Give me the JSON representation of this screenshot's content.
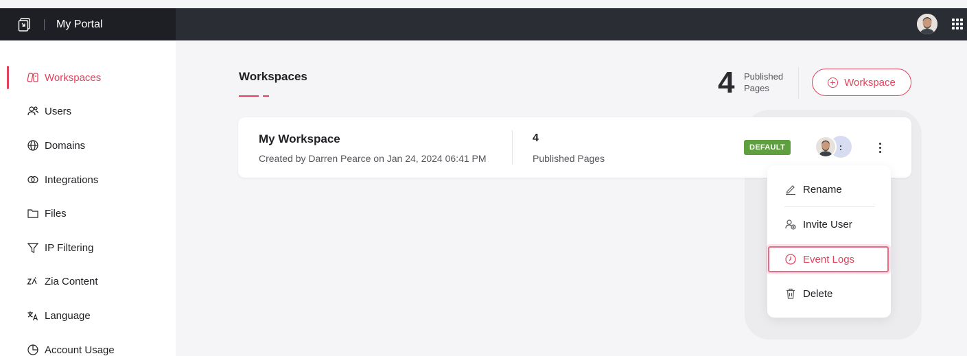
{
  "header": {
    "app_title": "My Portal",
    "logo_icon": "portal-logo-icon",
    "apps_icon": "grid-apps-icon"
  },
  "sidebar": {
    "items": [
      {
        "label": "Workspaces",
        "icon": "workspaces-icon",
        "active": true
      },
      {
        "label": "Users",
        "icon": "users-icon"
      },
      {
        "label": "Domains",
        "icon": "globe-icon"
      },
      {
        "label": "Integrations",
        "icon": "integrations-icon"
      },
      {
        "label": "Files",
        "icon": "folder-icon"
      },
      {
        "label": "IP Filtering",
        "icon": "filter-icon"
      },
      {
        "label": "Zia Content",
        "icon": "zia-icon"
      },
      {
        "label": "Language",
        "icon": "translate-icon"
      },
      {
        "label": "Account Usage",
        "icon": "pie-chart-icon"
      }
    ]
  },
  "main": {
    "title": "Workspaces",
    "stat": {
      "value": "4",
      "label": "Published Pages"
    },
    "add_button_label": "Workspace"
  },
  "workspace_card": {
    "name": "My Workspace",
    "created": "Created by Darren Pearce on Jan 24, 2024 06:41 PM",
    "published_count": "4",
    "published_label": "Published Pages",
    "badge": "DEFAULT",
    "avatar2_text": ":"
  },
  "menu": {
    "items": [
      {
        "label": "Rename",
        "icon": "pencil-icon"
      },
      {
        "label": "Invite User",
        "icon": "invite-user-icon"
      },
      {
        "label": "Event Logs",
        "icon": "clock-icon",
        "highlighted": true
      },
      {
        "label": "Delete",
        "icon": "trash-icon"
      }
    ]
  },
  "colors": {
    "accent": "#e0445c",
    "topbar": "#2b2d34",
    "badge": "#5e9f3f"
  }
}
